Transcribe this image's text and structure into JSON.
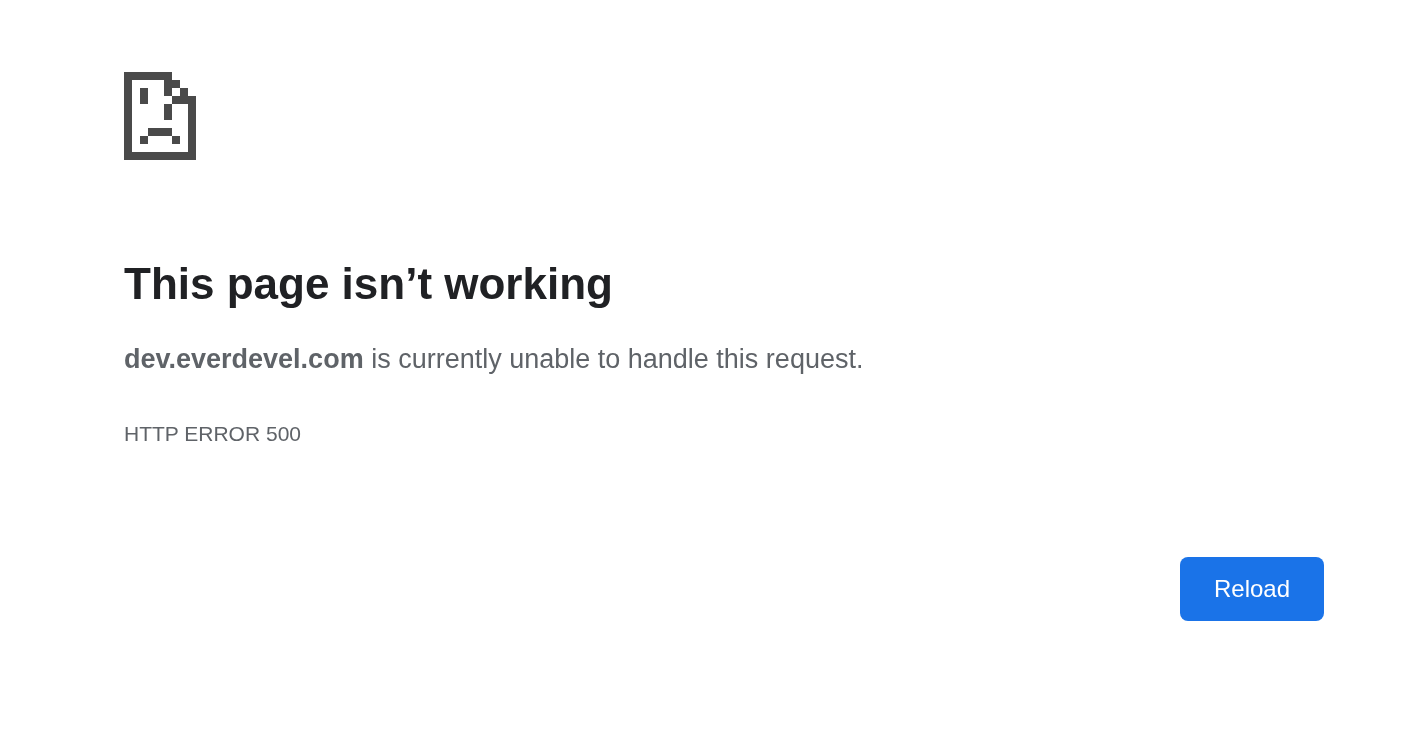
{
  "heading": "This page isn’t working",
  "message": "**dev.everdevel.com** is currently unable to handle this request.",
  "error_code": "HTTP ERROR 500",
  "button": {
    "label": "Reload"
  }
}
